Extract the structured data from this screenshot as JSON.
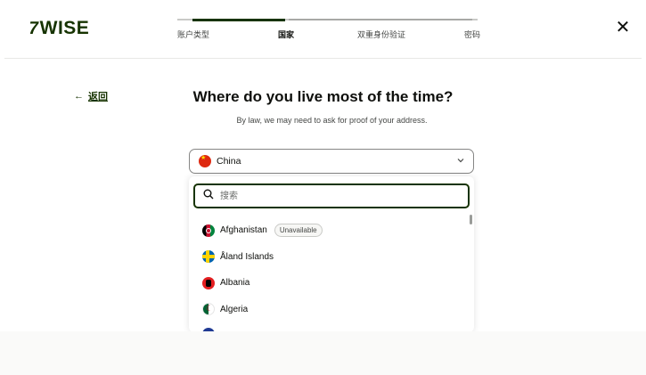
{
  "brand": {
    "logo_text": "WISE",
    "logo_mark": "7",
    "color": "#163300"
  },
  "steps": [
    {
      "label": "账户类型",
      "state": "done"
    },
    {
      "label": "国家",
      "state": "current"
    },
    {
      "label": "双重身份验证",
      "state": "upcoming"
    },
    {
      "label": "密码",
      "state": "upcoming"
    }
  ],
  "close_icon": "close-icon",
  "back": {
    "arrow": "←",
    "label": "返回"
  },
  "page": {
    "title": "Where do you live most of the time?",
    "subtitle": "By law, we may need to ask for proof of your address."
  },
  "country_select": {
    "value": "China",
    "flag": "flag-china",
    "chevron": "chevron-down-icon"
  },
  "search": {
    "placeholder": "搜索",
    "value": ""
  },
  "countries": [
    {
      "name": "Afghanistan",
      "flag": "flag-afghanistan",
      "badge": "Unavailable"
    },
    {
      "name": "Åland Islands",
      "flag": "flag-aland",
      "badge": ""
    },
    {
      "name": "Albania",
      "flag": "flag-albania",
      "badge": ""
    },
    {
      "name": "Algeria",
      "flag": "flag-algeria",
      "badge": ""
    }
  ],
  "colors": {
    "accent": "#163300",
    "text": "#0e0f0c",
    "muted": "#454745"
  }
}
